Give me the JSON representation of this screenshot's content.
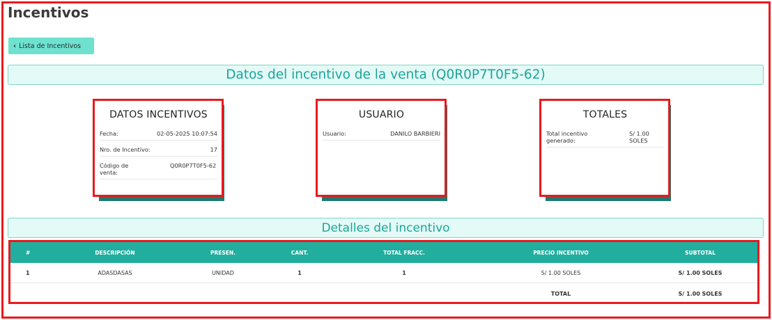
{
  "page": {
    "title": "Incentivos"
  },
  "nav": {
    "back_label": "Lista de Incentivos"
  },
  "section1": {
    "title": "Datos del incentivo de la venta (Q0R0P7T0F5-62)"
  },
  "cards": {
    "datos": {
      "title": "DATOS INCENTIVOS",
      "rows": [
        {
          "label": "Fecha:",
          "value": "02-05-2025 10:07:54"
        },
        {
          "label": "Nro. de Incentivo:",
          "value": "17"
        },
        {
          "label": "Código de venta:",
          "value": "Q0R0P7T0F5-62"
        }
      ]
    },
    "usuario": {
      "title": "USUARIO",
      "rows": [
        {
          "label": "Usuario:",
          "value": "DANILO BARBIERI"
        }
      ]
    },
    "totales": {
      "title": "TOTALES",
      "rows": [
        {
          "label": "Total incentivo generado:",
          "value": "S/ 1.00 SOLES"
        }
      ]
    }
  },
  "section2": {
    "title": "Detalles del incentivo"
  },
  "table": {
    "headers": [
      "#",
      "DESCRIPCIÓN",
      "PRESEN.",
      "CANT.",
      "TOTAL FRACC.",
      "PRECIO INCENTIVO",
      "SUBTOTAL"
    ],
    "rows": [
      [
        "1",
        "ADASDASAS",
        "UNIDAD",
        "1",
        "1",
        "S/ 1.00 SOLES",
        "S/ 1.00 SOLES"
      ]
    ],
    "total_label": "TOTAL",
    "total_value": "S/ 1.00 SOLES"
  },
  "colors": {
    "accent": "#21ae9f",
    "accent_light": "#e3faf6",
    "button": "#6fe1cf",
    "card_shadow": "#1f7a6e",
    "highlight_border": "#e8191d"
  }
}
